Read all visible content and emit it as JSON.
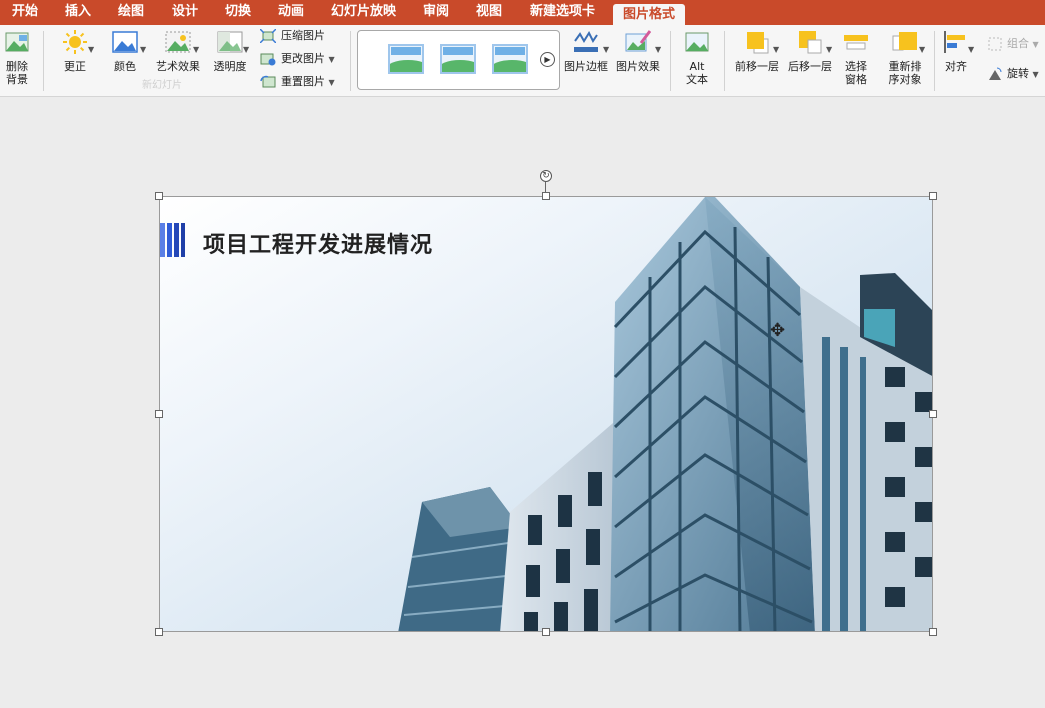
{
  "tabs": [
    {
      "label": "开始"
    },
    {
      "label": "插入"
    },
    {
      "label": "绘图"
    },
    {
      "label": "设计"
    },
    {
      "label": "切换"
    },
    {
      "label": "动画"
    },
    {
      "label": "幻灯片放映"
    },
    {
      "label": "审阅"
    },
    {
      "label": "视图"
    },
    {
      "label": "新建选项卡"
    },
    {
      "label": "图片格式"
    }
  ],
  "ribbon": {
    "remove_bg": {
      "line1": "删除",
      "line2": "背景"
    },
    "corrections": "更正",
    "color": "颜色",
    "artistic": "艺术效果",
    "transparency": "透明度",
    "compress": "压缩图片",
    "change": "更改图片",
    "reset": "重置图片",
    "border": "图片边框",
    "effects": "图片效果",
    "alt": {
      "line1": "Alt",
      "line2": "文本"
    },
    "forward": "前移一层",
    "backward": "后移一层",
    "selection": {
      "line1": "选择",
      "line2": "窗格"
    },
    "reorder": {
      "line1": "重新排",
      "line2": "序对象"
    },
    "align": "对齐",
    "group": "组合",
    "rotate": "旋转",
    "ghost_slide": "新幻灯片"
  },
  "slide": {
    "title": "项目工程开发进展情况"
  },
  "colors": {
    "tab_bar": "#c94a2a",
    "accent_blue": "#2f5bd6",
    "arrange_yellow": "#f7c21e"
  }
}
